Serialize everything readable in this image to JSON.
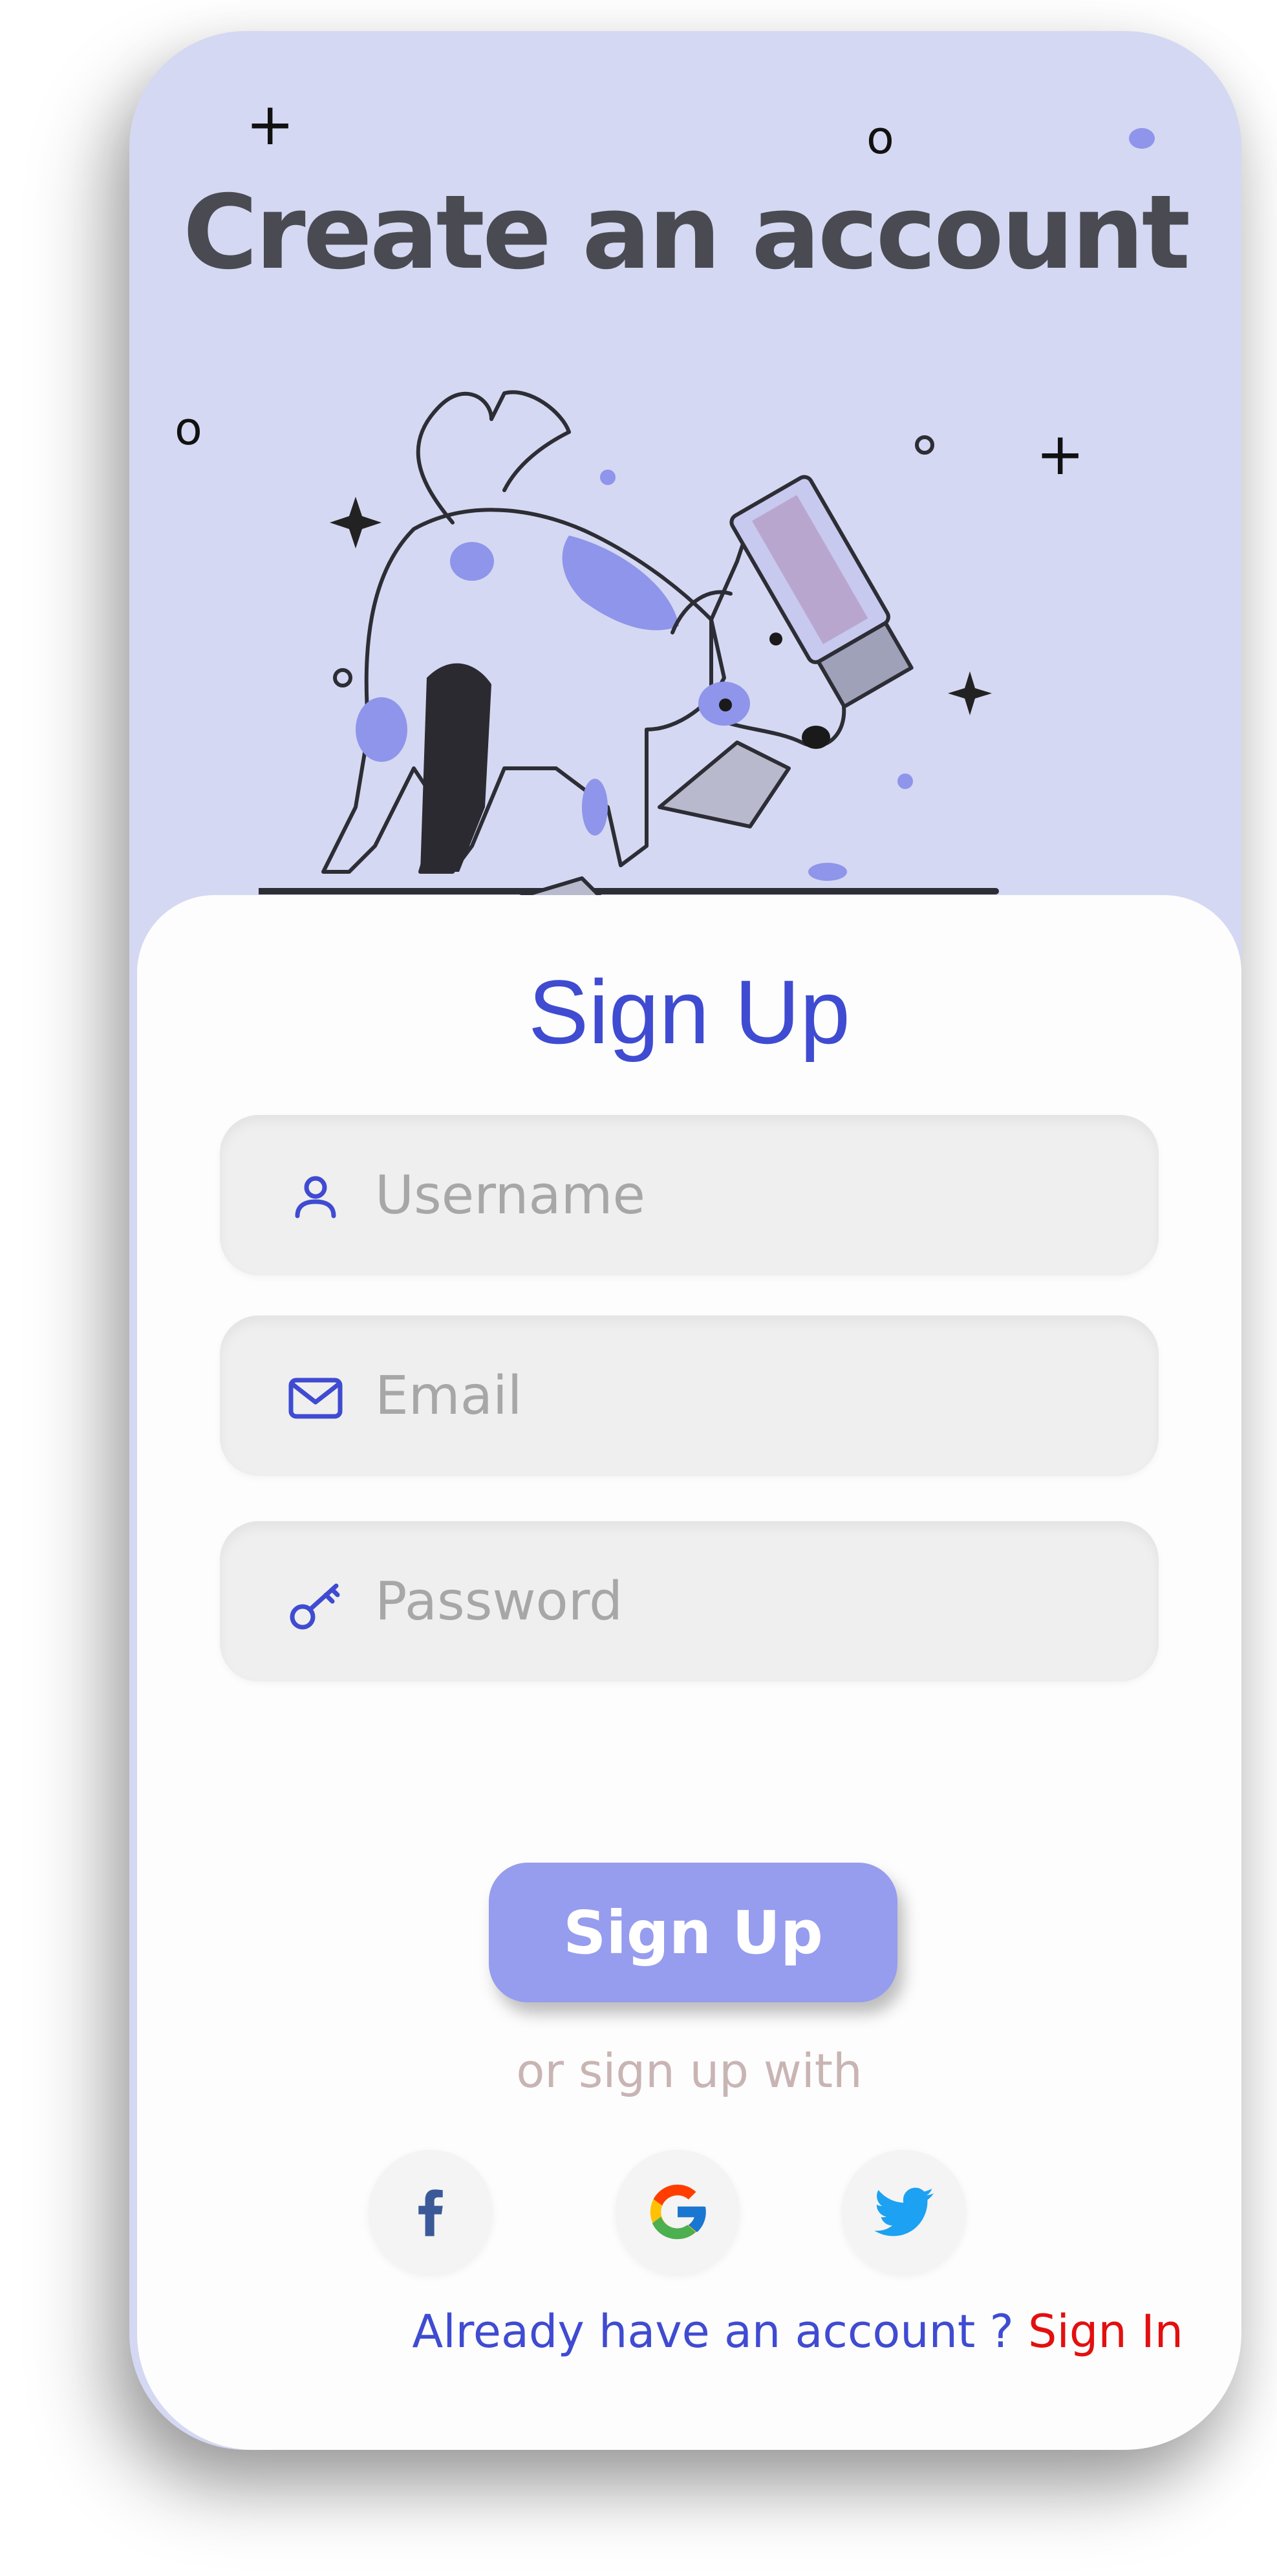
{
  "hero": {
    "title": "Create an account"
  },
  "card": {
    "title": "Sign Up",
    "fields": {
      "username": {
        "placeholder": "Username",
        "icon": "user-icon"
      },
      "email": {
        "placeholder": "Email",
        "icon": "mail-icon"
      },
      "password": {
        "placeholder": "Password",
        "icon": "key-icon"
      }
    },
    "submit_label": "Sign Up",
    "alt_text": "or sign up with",
    "social": [
      "facebook-icon",
      "google-icon",
      "twitter-icon"
    ],
    "signin_prompt": "Already have an account ? ",
    "signin_link": "Sign In"
  },
  "colors": {
    "background": "#d5d8f2",
    "accent": "#3f4bd1",
    "button": "#969cee",
    "link": "#e30f0f"
  }
}
